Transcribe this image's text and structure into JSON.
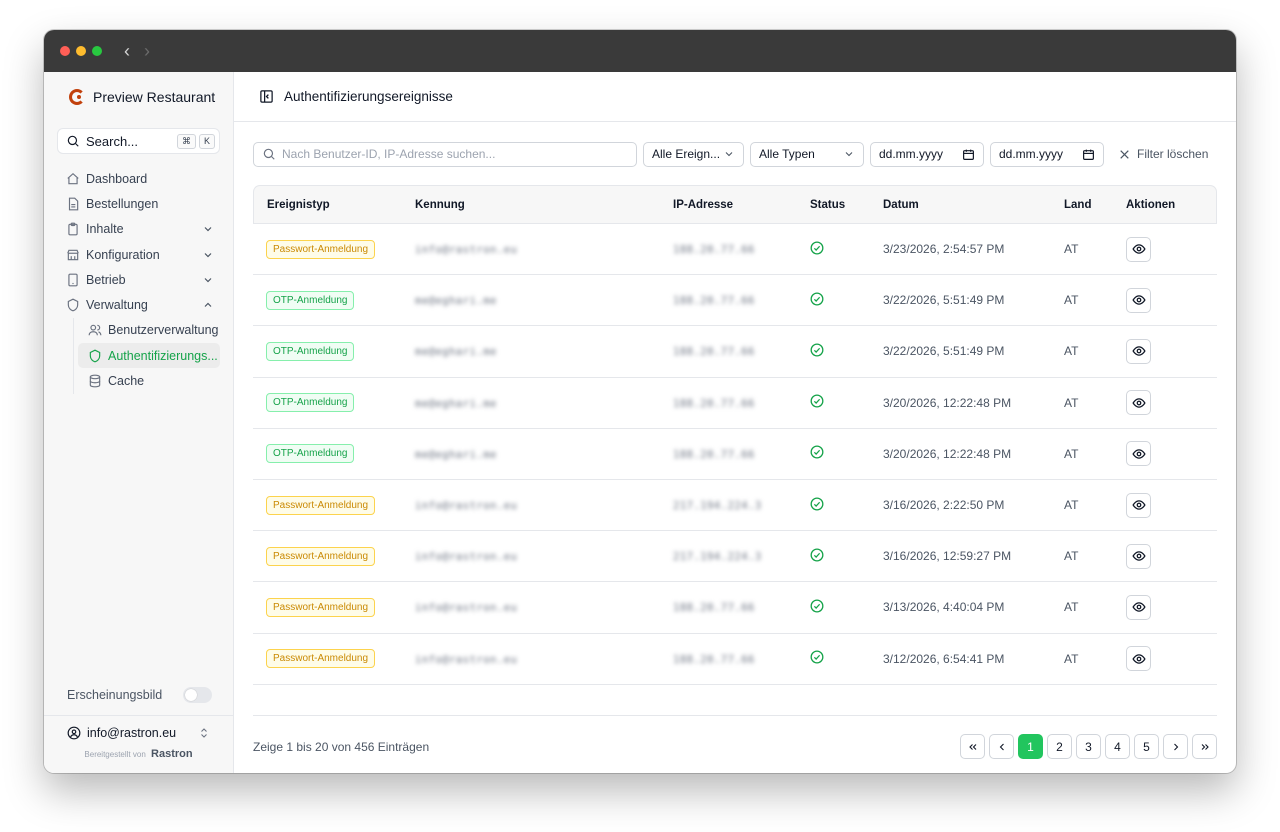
{
  "window": {
    "back_icon": "chevron-left",
    "forward_icon": "chevron-right"
  },
  "sidebar": {
    "brand": "Preview Restaurant",
    "search": {
      "label": "Search...",
      "kbd": [
        "⌘",
        "K"
      ]
    },
    "items": [
      {
        "label": "Dashboard",
        "icon": "home-icon"
      },
      {
        "label": "Bestellungen",
        "icon": "file-icon"
      },
      {
        "label": "Inhalte",
        "icon": "clipboard-icon",
        "expandable": true
      },
      {
        "label": "Konfiguration",
        "icon": "store-icon",
        "expandable": true
      },
      {
        "label": "Betrieb",
        "icon": "tablet-icon",
        "expandable": true
      },
      {
        "label": "Verwaltung",
        "icon": "shield-icon",
        "expandable": true,
        "expanded": true
      }
    ],
    "subitems": [
      {
        "label": "Benutzerverwaltung",
        "icon": "users-icon"
      },
      {
        "label": "Authentifizierungs...",
        "icon": "shield-icon",
        "active": true
      },
      {
        "label": "Cache",
        "icon": "database-icon"
      }
    ],
    "appearance_label": "Erscheinungsbild",
    "user_email": "info@rastron.eu",
    "powered_by": "Bereitgestellt von",
    "powered_brand": "Rastron"
  },
  "header": {
    "title": "Authentifizierungsereignisse"
  },
  "filters": {
    "search_placeholder": "Nach Benutzer-ID, IP-Adresse suchen...",
    "event_select": "Alle Ereign...",
    "type_select": "Alle Typen",
    "date_from": "dd.mm.yyyy",
    "date_to": "dd.mm.yyyy",
    "clear_label": "Filter löschen"
  },
  "table": {
    "columns": [
      "Ereignistyp",
      "Kennung",
      "IP-Adresse",
      "Status",
      "Datum",
      "Land",
      "Aktionen"
    ],
    "rows": [
      {
        "type": "Passwort-Anmeldung",
        "kind": "pw",
        "id": "info@rastron.eu",
        "ip": "188.20.77.66",
        "date": "3/23/2026, 2:54:57 PM",
        "country": "AT"
      },
      {
        "type": "OTP-Anmeldung",
        "kind": "otp",
        "id": "me@eghari.me",
        "ip": "188.20.77.66",
        "date": "3/22/2026, 5:51:49 PM",
        "country": "AT"
      },
      {
        "type": "OTP-Anmeldung",
        "kind": "otp",
        "id": "me@eghari.me",
        "ip": "188.20.77.66",
        "date": "3/22/2026, 5:51:49 PM",
        "country": "AT"
      },
      {
        "type": "OTP-Anmeldung",
        "kind": "otp",
        "id": "me@eghari.me",
        "ip": "188.20.77.66",
        "date": "3/20/2026, 12:22:48 PM",
        "country": "AT"
      },
      {
        "type": "OTP-Anmeldung",
        "kind": "otp",
        "id": "me@eghari.me",
        "ip": "188.20.77.66",
        "date": "3/20/2026, 12:22:48 PM",
        "country": "AT"
      },
      {
        "type": "Passwort-Anmeldung",
        "kind": "pw",
        "id": "info@rastron.eu",
        "ip": "217.194.224.3",
        "date": "3/16/2026, 2:22:50 PM",
        "country": "AT"
      },
      {
        "type": "Passwort-Anmeldung",
        "kind": "pw",
        "id": "info@rastron.eu",
        "ip": "217.194.224.3",
        "date": "3/16/2026, 12:59:27 PM",
        "country": "AT"
      },
      {
        "type": "Passwort-Anmeldung",
        "kind": "pw",
        "id": "info@rastron.eu",
        "ip": "188.20.77.66",
        "date": "3/13/2026, 4:40:04 PM",
        "country": "AT"
      },
      {
        "type": "Passwort-Anmeldung",
        "kind": "pw",
        "id": "info@rastron.eu",
        "ip": "188.20.77.66",
        "date": "3/12/2026, 6:54:41 PM",
        "country": "AT"
      }
    ]
  },
  "pagination": {
    "info": "Zeige 1 bis 20 von 456 Einträgen",
    "pages": [
      "1",
      "2",
      "3",
      "4",
      "5"
    ],
    "active": "1"
  },
  "colors": {
    "accent": "#22c55e",
    "warning": "#ca8a04",
    "brand": "#c2410c"
  }
}
